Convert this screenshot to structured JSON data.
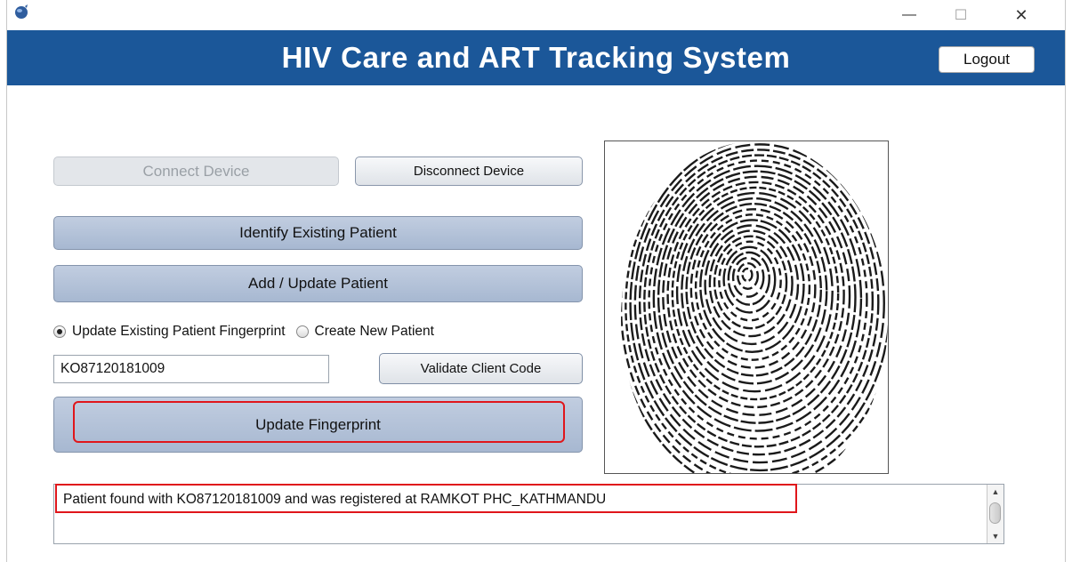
{
  "window": {
    "controls": {
      "minimize": "—",
      "maximize": "☐",
      "close": "✕"
    }
  },
  "header": {
    "title": "HIV Care and ART Tracking System",
    "logout_label": "Logout",
    "banner_color": "#1b5799"
  },
  "device": {
    "connect_label": "Connect Device",
    "disconnect_label": "Disconnect Device"
  },
  "actions": {
    "identify_label": "Identify Existing Patient",
    "add_update_label": "Add / Update Patient"
  },
  "mode": {
    "option_update_label": "Update Existing Patient Fingerprint",
    "option_create_label": "Create New Patient",
    "selected": "Update Existing Patient Fingerprint"
  },
  "client_code": {
    "value": "KO87120181009",
    "validate_label": "Validate Client Code"
  },
  "update_fingerprint_label": "Update Fingerprint",
  "message": {
    "text": "Patient found with KO87120181009 and was registered at RAMKOT PHC_KATHMANDU"
  },
  "colors": {
    "accent_highlight": "#e0161b",
    "button_blue": "#a7b8d1"
  }
}
